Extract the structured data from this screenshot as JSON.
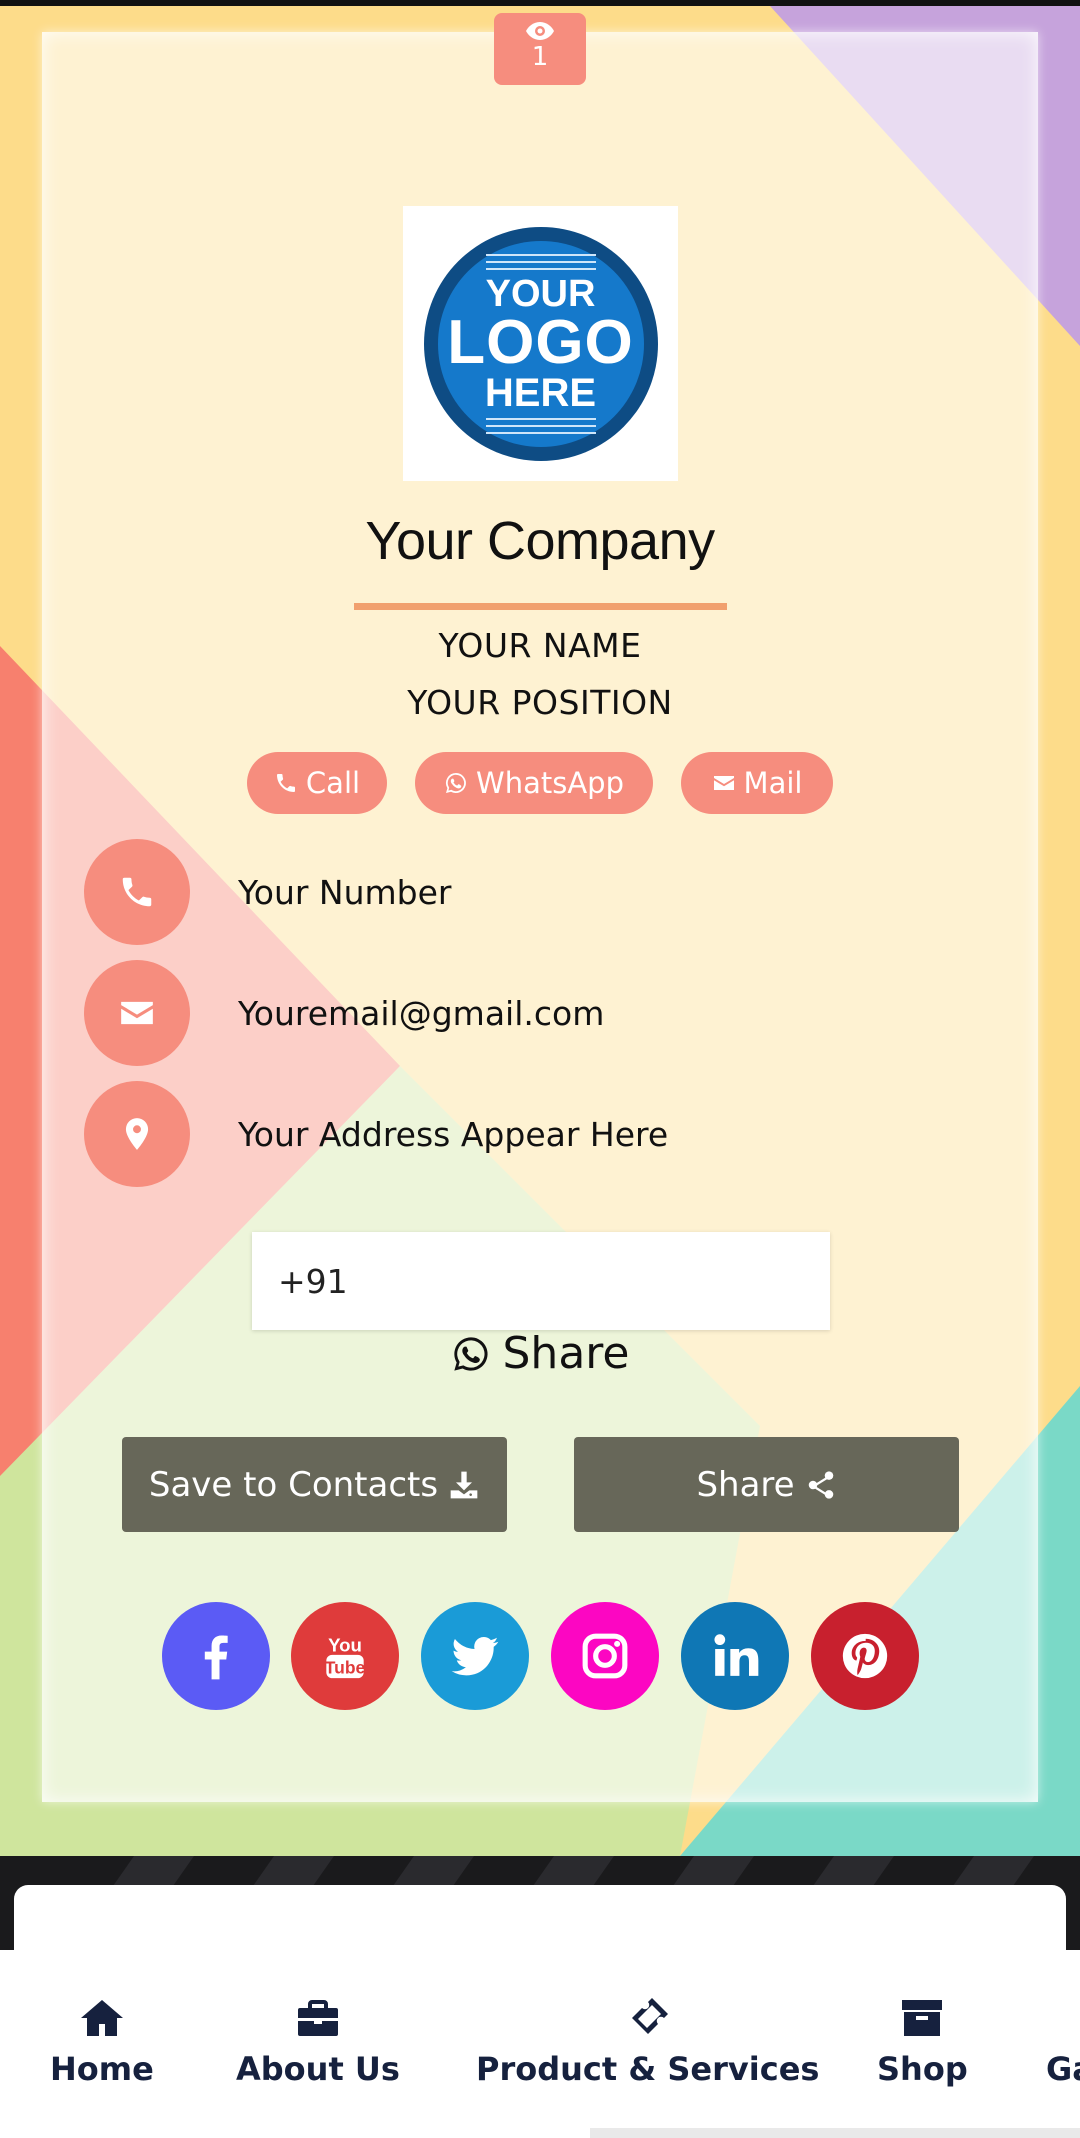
{
  "header": {
    "view_count": "1",
    "views_icon": "eye-icon"
  },
  "logo": {
    "line1": "YOUR",
    "line2": "LOGO",
    "line3": "HERE"
  },
  "profile": {
    "company": "Your Company",
    "name": "YOUR NAME",
    "position": "YOUR POSITION"
  },
  "actions": {
    "call": "Call",
    "whatsapp": "WhatsApp",
    "mail": "Mail"
  },
  "contacts": {
    "phone": "Your Number",
    "email": "Youremail@gmail.com",
    "address": "Your Address Appear Here"
  },
  "whatsapp_share": {
    "input_value": "+91",
    "button_label": "Share"
  },
  "buttons": {
    "save_contacts": "Save to Contacts",
    "share": "Share"
  },
  "social": [
    {
      "name": "facebook",
      "color": "#5b5bf5"
    },
    {
      "name": "youtube",
      "color": "#df3b3b"
    },
    {
      "name": "twitter",
      "color": "#1a9bd7"
    },
    {
      "name": "instagram",
      "color": "#fc06c2"
    },
    {
      "name": "linkedin",
      "color": "#0f77b5"
    },
    {
      "name": "pinterest",
      "color": "#c8202e"
    }
  ],
  "nav": {
    "home": "Home",
    "about": "About Us",
    "products": "Product & Services",
    "shop": "Shop",
    "gallery_partial": "Ga"
  },
  "colors": {
    "accent": "#f68d7e",
    "divider": "#f1a06e",
    "dark_button": "#676759",
    "nav_text": "#16213e"
  }
}
